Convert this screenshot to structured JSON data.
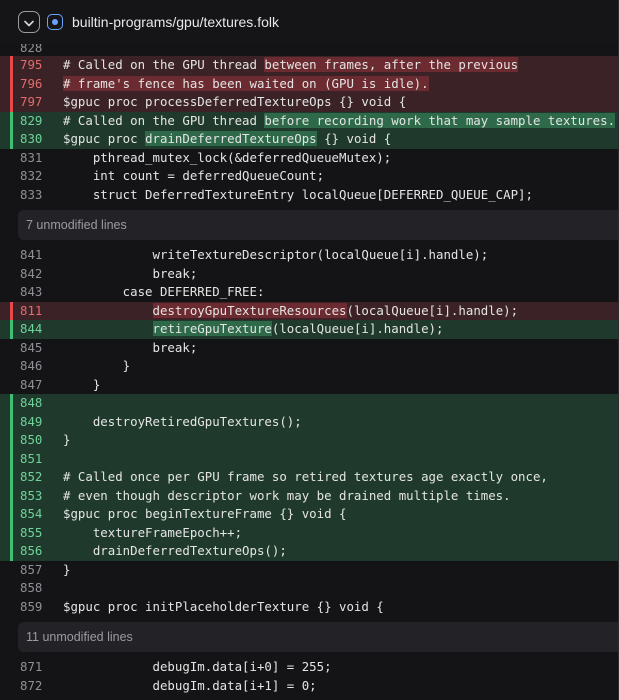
{
  "file": {
    "path": "builtin-programs/gpu/textures.folk",
    "collapse_icon": "chevron-down-icon",
    "file_icon": "file-diff-icon"
  },
  "colors": {
    "background": "#141416",
    "deleted_row": "#3a2226",
    "deleted_highlight": "#6b2b30",
    "added_row": "#1f3a2c",
    "added_highlight": "#2e6a49",
    "deleted_marker": "#e5484d",
    "added_marker": "#3fbf74"
  },
  "block1": [
    {
      "num": "828",
      "type": "ctx",
      "segs": [
        {
          "t": ""
        }
      ]
    },
    {
      "num": "795",
      "type": "del",
      "segs": [
        {
          "t": "# Called on the GPU thread "
        },
        {
          "t": "between frames, after the previous",
          "hl": true
        }
      ]
    },
    {
      "num": "796",
      "type": "del",
      "segs": [
        {
          "t": "# frame's fence has been waited on (GPU is idle).",
          "hl": true
        }
      ]
    },
    {
      "num": "797",
      "type": "del",
      "segs": [
        {
          "t": "$gpuc proc processDeferredTextureOps {} void {"
        }
      ]
    },
    {
      "num": "829",
      "type": "add",
      "segs": [
        {
          "t": "# Called on the GPU thread "
        },
        {
          "t": "before recording work that may sample textures.",
          "hl": true
        }
      ]
    },
    {
      "num": "830",
      "type": "add",
      "segs": [
        {
          "t": "$gpuc proc "
        },
        {
          "t": "drainDeferredTextureOps",
          "hl": true
        },
        {
          "t": " {} void {"
        }
      ]
    },
    {
      "num": "831",
      "type": "ctx",
      "segs": [
        {
          "t": "    pthread_mutex_lock(&deferredQueueMutex);"
        }
      ]
    },
    {
      "num": "832",
      "type": "ctx",
      "segs": [
        {
          "t": "    int count = deferredQueueCount;"
        }
      ]
    },
    {
      "num": "833",
      "type": "ctx",
      "segs": [
        {
          "t": "    struct DeferredTextureEntry localQueue[DEFERRED_QUEUE_CAP];"
        }
      ]
    }
  ],
  "hunk1": "7 unmodified lines",
  "block2": [
    {
      "num": "841",
      "type": "ctx",
      "segs": [
        {
          "t": "            writeTextureDescriptor(localQueue[i].handle);"
        }
      ]
    },
    {
      "num": "842",
      "type": "ctx",
      "segs": [
        {
          "t": "            break;"
        }
      ]
    },
    {
      "num": "843",
      "type": "ctx",
      "segs": [
        {
          "t": "        case DEFERRED_FREE:"
        }
      ]
    },
    {
      "num": "811",
      "type": "del",
      "segs": [
        {
          "t": "            "
        },
        {
          "t": "destroyGpuTextureResources",
          "hl": true
        },
        {
          "t": "(localQueue[i].handle);"
        }
      ]
    },
    {
      "num": "844",
      "type": "add",
      "segs": [
        {
          "t": "            "
        },
        {
          "t": "retireGpuTexture",
          "hl": true
        },
        {
          "t": "(localQueue[i].handle);"
        }
      ]
    },
    {
      "num": "845",
      "type": "ctx",
      "segs": [
        {
          "t": "            break;"
        }
      ]
    },
    {
      "num": "846",
      "type": "ctx",
      "segs": [
        {
          "t": "        }"
        }
      ]
    },
    {
      "num": "847",
      "type": "ctx",
      "segs": [
        {
          "t": "    }"
        }
      ]
    },
    {
      "num": "848",
      "type": "add",
      "segs": [
        {
          "t": ""
        }
      ]
    },
    {
      "num": "849",
      "type": "add",
      "segs": [
        {
          "t": "    destroyRetiredGpuTextures();"
        }
      ]
    },
    {
      "num": "850",
      "type": "add",
      "segs": [
        {
          "t": "}"
        }
      ]
    },
    {
      "num": "851",
      "type": "add",
      "segs": [
        {
          "t": ""
        }
      ]
    },
    {
      "num": "852",
      "type": "add",
      "segs": [
        {
          "t": "# Called once per GPU frame so retired textures age exactly once,"
        }
      ]
    },
    {
      "num": "853",
      "type": "add",
      "segs": [
        {
          "t": "# even though descriptor work may be drained multiple times."
        }
      ]
    },
    {
      "num": "854",
      "type": "add",
      "segs": [
        {
          "t": "$gpuc proc beginTextureFrame {} void {"
        }
      ]
    },
    {
      "num": "855",
      "type": "add",
      "segs": [
        {
          "t": "    textureFrameEpoch++;"
        }
      ]
    },
    {
      "num": "856",
      "type": "add",
      "segs": [
        {
          "t": "    drainDeferredTextureOps();"
        }
      ]
    },
    {
      "num": "857",
      "type": "ctx",
      "segs": [
        {
          "t": "}"
        }
      ]
    },
    {
      "num": "858",
      "type": "ctx",
      "segs": [
        {
          "t": ""
        }
      ]
    },
    {
      "num": "859",
      "type": "ctx",
      "segs": [
        {
          "t": "$gpuc proc initPlaceholderTexture {} void {"
        }
      ]
    }
  ],
  "hunk2": "11 unmodified lines",
  "block3": [
    {
      "num": "871",
      "type": "ctx",
      "segs": [
        {
          "t": "            debugIm.data[i+0] = 255;"
        }
      ]
    },
    {
      "num": "872",
      "type": "ctx",
      "segs": [
        {
          "t": "            debugIm.data[i+1] = 0;"
        }
      ]
    }
  ]
}
